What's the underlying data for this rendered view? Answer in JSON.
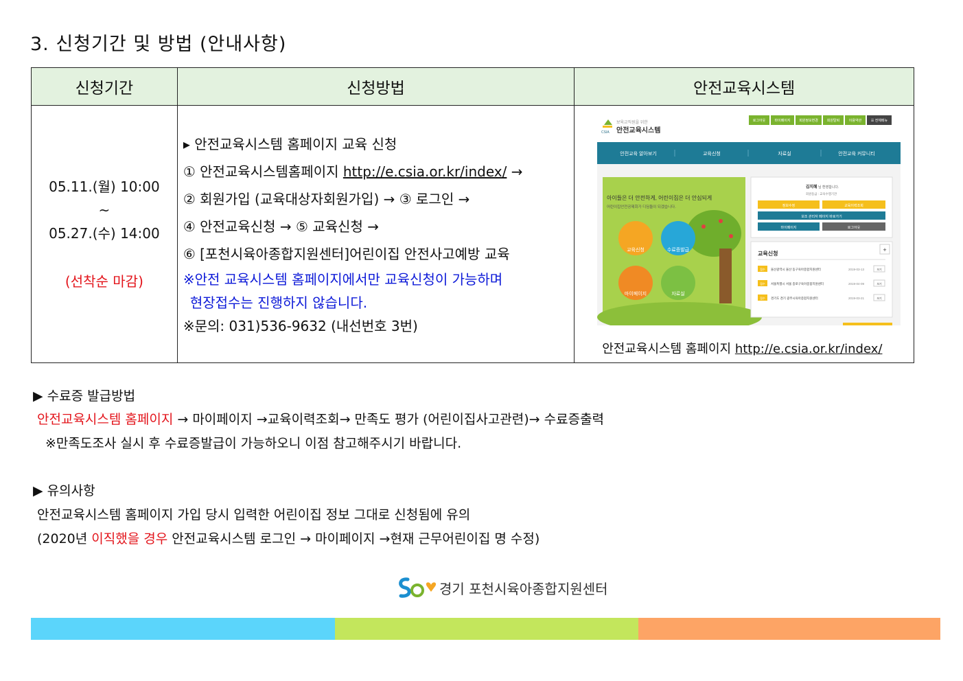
{
  "section_title": "3. 신청기간 및 방법 (안내사항)",
  "table": {
    "headers": [
      "신청기간",
      "신청방법",
      "안전교육시스템"
    ],
    "period": {
      "start": "05.11.(월) 10:00",
      "tilde": "~",
      "end": "05.27.(수) 14:00",
      "note": "(선착순 마감)"
    },
    "method": {
      "line1": "▸ 안전교육시스템 홈페이지 교육 신청",
      "line2_prefix": "① 안전교육시스템홈페이지 ",
      "line2_url": "http://e.csia.or.kr/index/",
      "line2_suffix": " →",
      "line3": "② 회원가입 (교육대상자회원가입) → ③ 로그인 →",
      "line4": "④ 안전교육신청 → ⑤ 교육신청 →",
      "line5": "⑥ [포천시육아종합지원센터]어린이집 안전사고예방 교육",
      "notice1": "※안전 교육시스템 홈페이지에서만 교육신청이 가능하며",
      "notice2": "현장접수는 진행하지 않습니다.",
      "contact": "※문의: 031)536-9632 (내선번호 3번)"
    },
    "system": {
      "caption_prefix": "안전교육시스템 홈페이지 ",
      "caption_url": "http://e.csia.or.kr/index/",
      "screenshot": {
        "logo_sub": "보육교직원을 위한",
        "logo_text": "안전교육시스템",
        "logo_mark": "CSIA",
        "top_buttons": [
          "로그아웃",
          "마이페이지",
          "회원정보변경",
          "회원탈퇴",
          "이용약관"
        ],
        "all_menu": "☰ 전체메뉴",
        "nav": [
          "안전교육 알아보기",
          "교육신청",
          "자료실",
          "안전교육 커뮤니티"
        ],
        "banner_title": "아이들은 더 안전하게, 어린이집은 더 안심되게",
        "banner_sub": "어린이집안전공제회가 디딤돌이 되겠습니다.",
        "circles": [
          "교육신청",
          "수료증발급",
          "마이페이지",
          "자료실"
        ],
        "user_name": "김지혜",
        "user_welcome": "님 환영합니다.",
        "user_grade": "회원등급 : 교육수행기관",
        "user_buttons": [
          "정보수정",
          "교육이력조회",
          "보조 관리자 페이지 바로가기",
          "마이페이지",
          "로그아웃"
        ],
        "edu_title": "교육신청",
        "plus": "+",
        "edu_rows": [
          {
            "badge": "접수",
            "name": "울산광역시 울산 동구육아종합지원센터",
            "date": "2019-03-13",
            "btn": "보기"
          },
          {
            "badge": "접수",
            "name": "서울특별시 서울 종로구육아종합지원센터",
            "date": "2019-04-09",
            "btn": "보기"
          },
          {
            "badge": "접수",
            "name": "경기도 경기 광주시육아종합지원센터",
            "date": "2019-03-21",
            "btn": "보기"
          }
        ]
      }
    }
  },
  "certificate": {
    "heading": "▶ 수료증 발급방법",
    "flow_red": "안전교육시스템 홈페이지",
    "flow_rest": " → 마이페이지 →교육이력조회→ 만족도 평가 (어린이집사고관련)→ 수료증출력",
    "note": "※만족도조사 실시 후 수료증발급이 가능하오니 이점 참고해주시기 바랍니다."
  },
  "caution": {
    "heading": "▶ 유의사항",
    "line1": "안전교육시스템 홈페이지 가입 당시 입력한 어린이집 정보 그대로 신청됨에 유의",
    "line2_prefix": "(2020년 ",
    "line2_red": "이직했을 경우",
    "line2_suffix": " 안전교육시스템 로그인 → 마이페이지 →현재 근무어린이집 명 수정)"
  },
  "footer": {
    "org_name": "경기 포천시육아종합지원센터",
    "bar_colors": [
      "#5bd5fb",
      "#c3e65c",
      "#fda465"
    ]
  },
  "colors": {
    "header_bg": "#e3f2df",
    "red": "#e3141b",
    "blue": "#0d1ad8",
    "site_teal": "#1e7b96",
    "site_yellow": "#f5bf1c"
  }
}
